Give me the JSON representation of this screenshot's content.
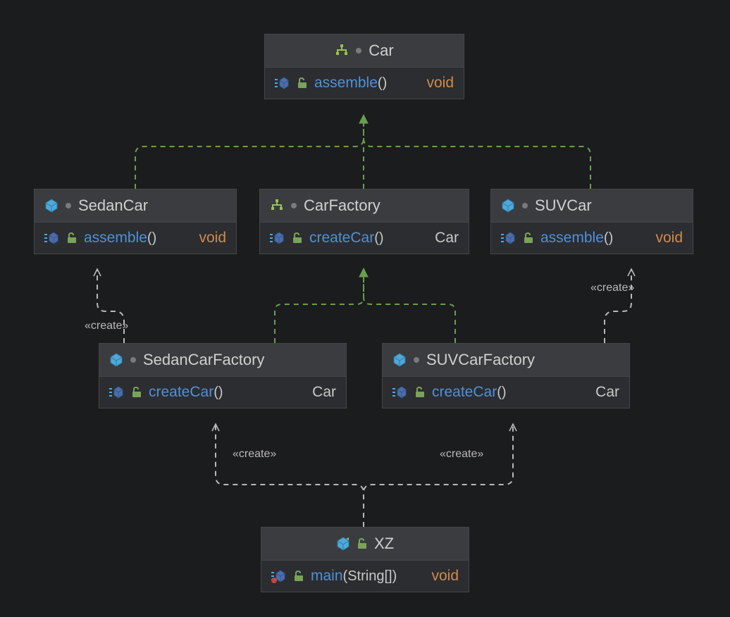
{
  "classes": {
    "car": {
      "name": "Car",
      "methods": [
        {
          "name": "assemble",
          "params": "",
          "returns": "void"
        }
      ]
    },
    "sedanCar": {
      "name": "SedanCar",
      "methods": [
        {
          "name": "assemble",
          "params": "",
          "returns": "void"
        }
      ]
    },
    "carFactory": {
      "name": "CarFactory",
      "methods": [
        {
          "name": "createCar",
          "params": "",
          "returns": "Car"
        }
      ]
    },
    "suvCar": {
      "name": "SUVCar",
      "methods": [
        {
          "name": "assemble",
          "params": "",
          "returns": "void"
        }
      ]
    },
    "sedanCarFactory": {
      "name": "SedanCarFactory",
      "methods": [
        {
          "name": "createCar",
          "params": "",
          "returns": "Car"
        }
      ]
    },
    "suvCarFactory": {
      "name": "SUVCarFactory",
      "methods": [
        {
          "name": "createCar",
          "params": "",
          "returns": "Car"
        }
      ]
    },
    "xz": {
      "name": "XZ",
      "methods": [
        {
          "name": "main",
          "params": "String[]",
          "returns": "void"
        }
      ]
    }
  },
  "stereotypes": {
    "create": "«create»"
  },
  "relations": [
    {
      "from": "sedanCar",
      "to": "car",
      "kind": "realization"
    },
    {
      "from": "carFactory",
      "to": "car",
      "kind": "realization"
    },
    {
      "from": "suvCar",
      "to": "car",
      "kind": "realization"
    },
    {
      "from": "sedanCarFactory",
      "to": "carFactory",
      "kind": "realization"
    },
    {
      "from": "suvCarFactory",
      "to": "carFactory",
      "kind": "realization"
    },
    {
      "from": "sedanCarFactory",
      "to": "sedanCar",
      "kind": "create"
    },
    {
      "from": "suvCarFactory",
      "to": "suvCar",
      "kind": "create"
    },
    {
      "from": "xz",
      "to": "sedanCarFactory",
      "kind": "create"
    },
    {
      "from": "xz",
      "to": "suvCarFactory",
      "kind": "create"
    }
  ],
  "colors": {
    "realization": "#6a9e4f",
    "dependency": "#a8a8a8",
    "interfaceIcon": "#9bbf55",
    "classIcon": "#4fa9d8",
    "methodIcon": "#4d6ea9",
    "unlockIcon": "#7aa35a",
    "staticIcon": "#c04747"
  }
}
